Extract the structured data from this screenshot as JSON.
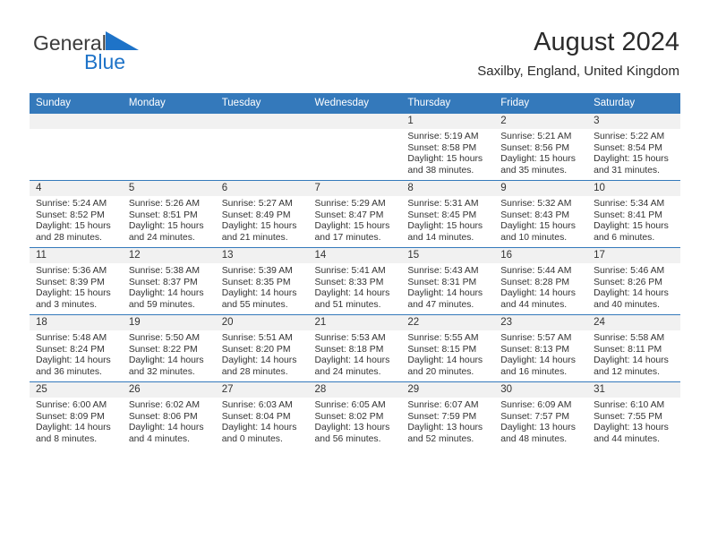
{
  "brand": {
    "name_top": "General",
    "name_bottom": "Blue",
    "mark": "triangle-icon",
    "color_top": "#3b3b3b",
    "color_bottom": "#1e73c8"
  },
  "header": {
    "title": "August 2024",
    "subtitle": "Saxilby, England, United Kingdom"
  },
  "theme": {
    "header_bg": "#3479bb",
    "header_text": "#ffffff",
    "daynum_bg": "#f1f1f1",
    "rule": "#3479bb",
    "text": "#333333"
  },
  "weekdays": [
    "Sunday",
    "Monday",
    "Tuesday",
    "Wednesday",
    "Thursday",
    "Friday",
    "Saturday"
  ],
  "weeks": [
    [
      {
        "day": "",
        "sunrise": "",
        "sunset": "",
        "daylight_line1": "",
        "daylight_line2": ""
      },
      {
        "day": "",
        "sunrise": "",
        "sunset": "",
        "daylight_line1": "",
        "daylight_line2": ""
      },
      {
        "day": "",
        "sunrise": "",
        "sunset": "",
        "daylight_line1": "",
        "daylight_line2": ""
      },
      {
        "day": "",
        "sunrise": "",
        "sunset": "",
        "daylight_line1": "",
        "daylight_line2": ""
      },
      {
        "day": "1",
        "sunrise": "Sunrise: 5:19 AM",
        "sunset": "Sunset: 8:58 PM",
        "daylight_line1": "Daylight: 15 hours",
        "daylight_line2": "and 38 minutes."
      },
      {
        "day": "2",
        "sunrise": "Sunrise: 5:21 AM",
        "sunset": "Sunset: 8:56 PM",
        "daylight_line1": "Daylight: 15 hours",
        "daylight_line2": "and 35 minutes."
      },
      {
        "day": "3",
        "sunrise": "Sunrise: 5:22 AM",
        "sunset": "Sunset: 8:54 PM",
        "daylight_line1": "Daylight: 15 hours",
        "daylight_line2": "and 31 minutes."
      }
    ],
    [
      {
        "day": "4",
        "sunrise": "Sunrise: 5:24 AM",
        "sunset": "Sunset: 8:52 PM",
        "daylight_line1": "Daylight: 15 hours",
        "daylight_line2": "and 28 minutes."
      },
      {
        "day": "5",
        "sunrise": "Sunrise: 5:26 AM",
        "sunset": "Sunset: 8:51 PM",
        "daylight_line1": "Daylight: 15 hours",
        "daylight_line2": "and 24 minutes."
      },
      {
        "day": "6",
        "sunrise": "Sunrise: 5:27 AM",
        "sunset": "Sunset: 8:49 PM",
        "daylight_line1": "Daylight: 15 hours",
        "daylight_line2": "and 21 minutes."
      },
      {
        "day": "7",
        "sunrise": "Sunrise: 5:29 AM",
        "sunset": "Sunset: 8:47 PM",
        "daylight_line1": "Daylight: 15 hours",
        "daylight_line2": "and 17 minutes."
      },
      {
        "day": "8",
        "sunrise": "Sunrise: 5:31 AM",
        "sunset": "Sunset: 8:45 PM",
        "daylight_line1": "Daylight: 15 hours",
        "daylight_line2": "and 14 minutes."
      },
      {
        "day": "9",
        "sunrise": "Sunrise: 5:32 AM",
        "sunset": "Sunset: 8:43 PM",
        "daylight_line1": "Daylight: 15 hours",
        "daylight_line2": "and 10 minutes."
      },
      {
        "day": "10",
        "sunrise": "Sunrise: 5:34 AM",
        "sunset": "Sunset: 8:41 PM",
        "daylight_line1": "Daylight: 15 hours",
        "daylight_line2": "and 6 minutes."
      }
    ],
    [
      {
        "day": "11",
        "sunrise": "Sunrise: 5:36 AM",
        "sunset": "Sunset: 8:39 PM",
        "daylight_line1": "Daylight: 15 hours",
        "daylight_line2": "and 3 minutes."
      },
      {
        "day": "12",
        "sunrise": "Sunrise: 5:38 AM",
        "sunset": "Sunset: 8:37 PM",
        "daylight_line1": "Daylight: 14 hours",
        "daylight_line2": "and 59 minutes."
      },
      {
        "day": "13",
        "sunrise": "Sunrise: 5:39 AM",
        "sunset": "Sunset: 8:35 PM",
        "daylight_line1": "Daylight: 14 hours",
        "daylight_line2": "and 55 minutes."
      },
      {
        "day": "14",
        "sunrise": "Sunrise: 5:41 AM",
        "sunset": "Sunset: 8:33 PM",
        "daylight_line1": "Daylight: 14 hours",
        "daylight_line2": "and 51 minutes."
      },
      {
        "day": "15",
        "sunrise": "Sunrise: 5:43 AM",
        "sunset": "Sunset: 8:31 PM",
        "daylight_line1": "Daylight: 14 hours",
        "daylight_line2": "and 47 minutes."
      },
      {
        "day": "16",
        "sunrise": "Sunrise: 5:44 AM",
        "sunset": "Sunset: 8:28 PM",
        "daylight_line1": "Daylight: 14 hours",
        "daylight_line2": "and 44 minutes."
      },
      {
        "day": "17",
        "sunrise": "Sunrise: 5:46 AM",
        "sunset": "Sunset: 8:26 PM",
        "daylight_line1": "Daylight: 14 hours",
        "daylight_line2": "and 40 minutes."
      }
    ],
    [
      {
        "day": "18",
        "sunrise": "Sunrise: 5:48 AM",
        "sunset": "Sunset: 8:24 PM",
        "daylight_line1": "Daylight: 14 hours",
        "daylight_line2": "and 36 minutes."
      },
      {
        "day": "19",
        "sunrise": "Sunrise: 5:50 AM",
        "sunset": "Sunset: 8:22 PM",
        "daylight_line1": "Daylight: 14 hours",
        "daylight_line2": "and 32 minutes."
      },
      {
        "day": "20",
        "sunrise": "Sunrise: 5:51 AM",
        "sunset": "Sunset: 8:20 PM",
        "daylight_line1": "Daylight: 14 hours",
        "daylight_line2": "and 28 minutes."
      },
      {
        "day": "21",
        "sunrise": "Sunrise: 5:53 AM",
        "sunset": "Sunset: 8:18 PM",
        "daylight_line1": "Daylight: 14 hours",
        "daylight_line2": "and 24 minutes."
      },
      {
        "day": "22",
        "sunrise": "Sunrise: 5:55 AM",
        "sunset": "Sunset: 8:15 PM",
        "daylight_line1": "Daylight: 14 hours",
        "daylight_line2": "and 20 minutes."
      },
      {
        "day": "23",
        "sunrise": "Sunrise: 5:57 AM",
        "sunset": "Sunset: 8:13 PM",
        "daylight_line1": "Daylight: 14 hours",
        "daylight_line2": "and 16 minutes."
      },
      {
        "day": "24",
        "sunrise": "Sunrise: 5:58 AM",
        "sunset": "Sunset: 8:11 PM",
        "daylight_line1": "Daylight: 14 hours",
        "daylight_line2": "and 12 minutes."
      }
    ],
    [
      {
        "day": "25",
        "sunrise": "Sunrise: 6:00 AM",
        "sunset": "Sunset: 8:09 PM",
        "daylight_line1": "Daylight: 14 hours",
        "daylight_line2": "and 8 minutes."
      },
      {
        "day": "26",
        "sunrise": "Sunrise: 6:02 AM",
        "sunset": "Sunset: 8:06 PM",
        "daylight_line1": "Daylight: 14 hours",
        "daylight_line2": "and 4 minutes."
      },
      {
        "day": "27",
        "sunrise": "Sunrise: 6:03 AM",
        "sunset": "Sunset: 8:04 PM",
        "daylight_line1": "Daylight: 14 hours",
        "daylight_line2": "and 0 minutes."
      },
      {
        "day": "28",
        "sunrise": "Sunrise: 6:05 AM",
        "sunset": "Sunset: 8:02 PM",
        "daylight_line1": "Daylight: 13 hours",
        "daylight_line2": "and 56 minutes."
      },
      {
        "day": "29",
        "sunrise": "Sunrise: 6:07 AM",
        "sunset": "Sunset: 7:59 PM",
        "daylight_line1": "Daylight: 13 hours",
        "daylight_line2": "and 52 minutes."
      },
      {
        "day": "30",
        "sunrise": "Sunrise: 6:09 AM",
        "sunset": "Sunset: 7:57 PM",
        "daylight_line1": "Daylight: 13 hours",
        "daylight_line2": "and 48 minutes."
      },
      {
        "day": "31",
        "sunrise": "Sunrise: 6:10 AM",
        "sunset": "Sunset: 7:55 PM",
        "daylight_line1": "Daylight: 13 hours",
        "daylight_line2": "and 44 minutes."
      }
    ]
  ]
}
